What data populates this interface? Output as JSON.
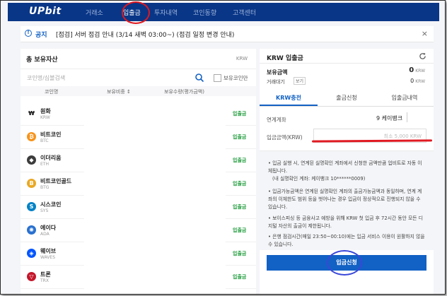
{
  "nav": {
    "logo": "UPbit",
    "items": [
      "거래소",
      "입출금",
      "투자내역",
      "코인동향",
      "고객센터"
    ],
    "active_index": 1
  },
  "notice": {
    "label": "공지",
    "text": "[점검] 서버 점검 안내 (3/14 새벽 03:00~) (점검 일정 변경 안내)",
    "close": "×"
  },
  "left": {
    "title": "총 보유자산",
    "unit": "KRW",
    "search_placeholder": "코인명/심볼검색",
    "hold_only_label": "보유코인만",
    "columns": [
      "코인명",
      "보유비중 ↕",
      "보유수량(평가금액)"
    ],
    "assets": [
      {
        "name": "원화",
        "code": "KRW",
        "icon": "won-icon",
        "color": "#ffffff",
        "action": "입출금"
      },
      {
        "name": "비트코인",
        "code": "BTC",
        "icon": "bitcoin-icon",
        "color": "#f7931a",
        "action": "입출금"
      },
      {
        "name": "이더리움",
        "code": "ETH",
        "icon": "ethereum-icon",
        "color": "#3c3c3d",
        "action": "입출금"
      },
      {
        "name": "비트코인골드",
        "code": "BTG",
        "icon": "bitcoin-gold-icon",
        "color": "#e9a825",
        "action": "입출금"
      },
      {
        "name": "시스코인",
        "code": "SYS",
        "icon": "syscoin-icon",
        "color": "#0082c6",
        "action": "입출금"
      },
      {
        "name": "에이다",
        "code": "ADA",
        "icon": "ada-icon",
        "color": "#2a71d0",
        "action": "입출금"
      },
      {
        "name": "웨이브",
        "code": "WAVES",
        "icon": "waves-icon",
        "color": "#0155ff",
        "action": "입출금"
      },
      {
        "name": "트론",
        "code": "TRX",
        "icon": "tron-icon",
        "color": "#c4162a",
        "action": "입출금"
      }
    ]
  },
  "right": {
    "title": "KRW 입출금",
    "balance_label": "보유금액",
    "balance_value": "0",
    "balance_unit": "KRW",
    "wait_label": "거래대기",
    "wait_button": "보기",
    "wait_value": "0",
    "wait_unit": "KRW",
    "tabs": [
      "KRW충전",
      "출금신청",
      "입출금내역"
    ],
    "account_label": "연계계좌",
    "account_value": "9 케이뱅크",
    "amount_label": "입금금액(KRW)",
    "amount_placeholder": "최소 5,000 KRW",
    "notes": [
      "• 입금 실행 시, 연계된 실명확인 계좌에서 신청한 금액만큼 업비트로 자동 이체됩니다.",
      "(내 실명확인 계좌: 케이뱅크 10******0009)",
      "• 입금가능금액은 연계된 실명확인 계좌의 출금가능금액과 동일하며, 연계 계좌의 이체한도 범위 등을 벗어나는 경우 입금이 정상적으로 진행되지 않을 수 있습니다.",
      "• 보이스피싱 등 금융사고 예방을 위해 KRW 첫 입금 후 72시간 동안 모든 디지털 자산의 출금이 제한됩니다.",
      "• 은행 점검시간(매일 23:50~00:10)에는 입금 서비스 이용이 원활하지 않을 수 있습니다."
    ],
    "submit": "입금신청"
  }
}
